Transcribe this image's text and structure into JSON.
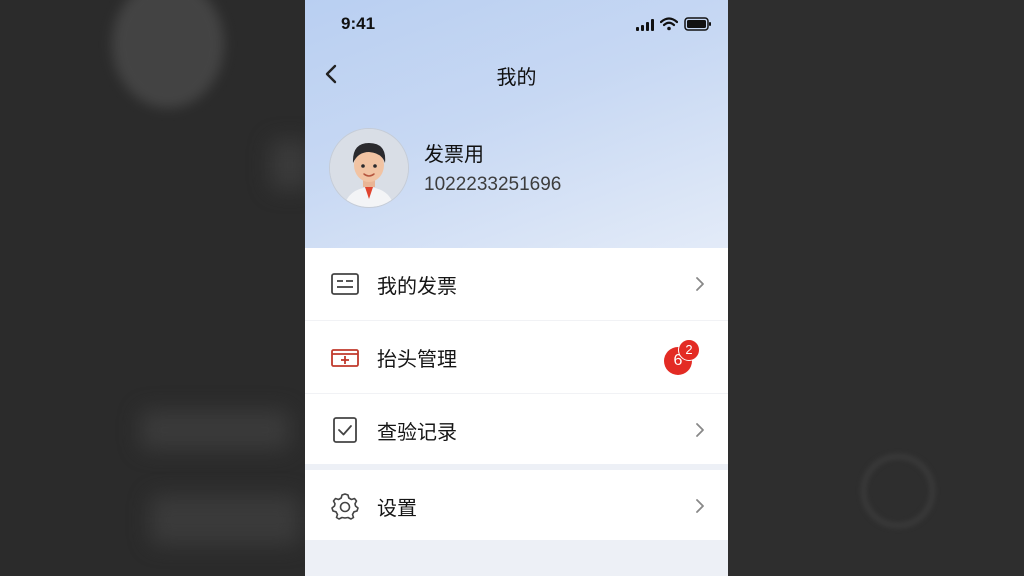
{
  "status_bar": {
    "time": "9:41"
  },
  "nav": {
    "title": "我的"
  },
  "profile": {
    "name": "发票用",
    "id": "1022233251696"
  },
  "menu": {
    "items": [
      {
        "label": "我的发票",
        "icon": "invoice-icon"
      },
      {
        "label": "抬头管理",
        "icon": "title-manage-icon",
        "badge_main": "6",
        "badge_small": "2"
      },
      {
        "label": "查验记录",
        "icon": "check-record-icon"
      }
    ],
    "settings": {
      "label": "设置",
      "icon": "gear-icon"
    }
  },
  "colors": {
    "accent_gradient_start": "#b9cff2",
    "badge": "#e32b24",
    "title_icon": "#c0392b"
  }
}
